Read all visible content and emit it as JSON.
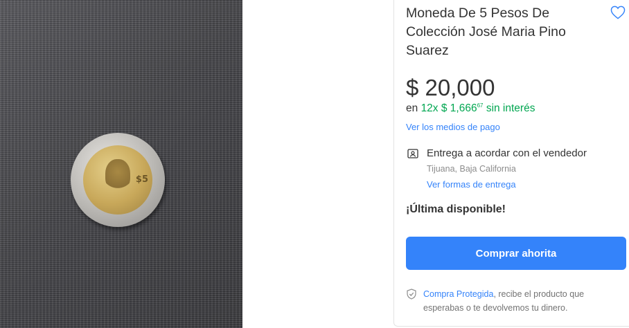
{
  "product": {
    "title": "Moneda De 5 Pesos De Colección José Maria Pino Suarez",
    "price": "$ 20,000",
    "installments": {
      "prefix": "en",
      "count": "12x",
      "amount": "$ 1,666",
      "cents": "67",
      "suffix": "sin interés"
    },
    "payment_link": "Ver los medios de pago",
    "stock": "¡Última disponible!"
  },
  "delivery": {
    "title": "Entrega a acordar con el vendedor",
    "location": "Tijuana, Baja California",
    "link": "Ver formas de entrega"
  },
  "buy_button": "Comprar ahorita",
  "protection": {
    "link": "Compra Protegida",
    "text": ", recibe el producto que esperabas o te devolvemos tu dinero."
  },
  "icons": {
    "favorite": "heart-outline-icon",
    "delivery": "person-card-icon",
    "protection": "shield-check-icon"
  },
  "colors": {
    "accent": "#3483fa",
    "green": "#00a650",
    "text": "#333333",
    "muted": "#8c8c8c"
  }
}
